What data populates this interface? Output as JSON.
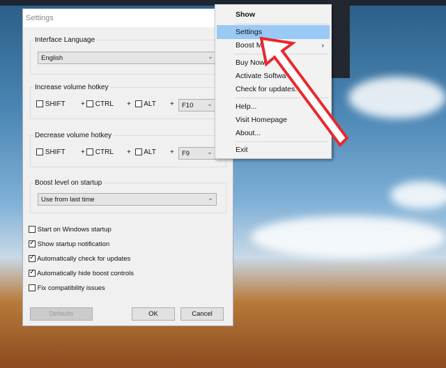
{
  "dialog": {
    "title": "Settings",
    "language": {
      "label": "Interface Language",
      "value": "English"
    },
    "increase": {
      "label": "Increase volume hotkey",
      "shift": "SHIFT",
      "ctrl": "CTRL",
      "alt": "ALT",
      "plus": "+",
      "key": "F10"
    },
    "decrease": {
      "label": "Decrease volume hotkey",
      "shift": "SHIFT",
      "ctrl": "CTRL",
      "alt": "ALT",
      "plus": "+",
      "key": "F9"
    },
    "boost": {
      "label": "Boost level on startup",
      "value": "Use from last time"
    },
    "options": [
      {
        "label": "Start on Windows startup",
        "checked": false
      },
      {
        "label": "Show startup notification",
        "checked": true
      },
      {
        "label": "Automatically check for updates",
        "checked": true
      },
      {
        "label": "Automatically hide boost controls",
        "checked": true
      },
      {
        "label": "Fix compatibility issues",
        "checked": false
      }
    ],
    "buttons": {
      "defaults": "Defaults",
      "ok": "OK",
      "cancel": "Cancel"
    }
  },
  "menu": {
    "items": [
      "Show",
      "Settings",
      "Boost M",
      "Buy Now!",
      "Activate Softwa",
      "Check for updates.",
      "Help...",
      "Visit Homepage",
      "About...",
      "Exit"
    ],
    "submenu_arrow": "›"
  },
  "colors": {
    "highlight": "#99c9f5",
    "arrow": "#e8282e"
  }
}
